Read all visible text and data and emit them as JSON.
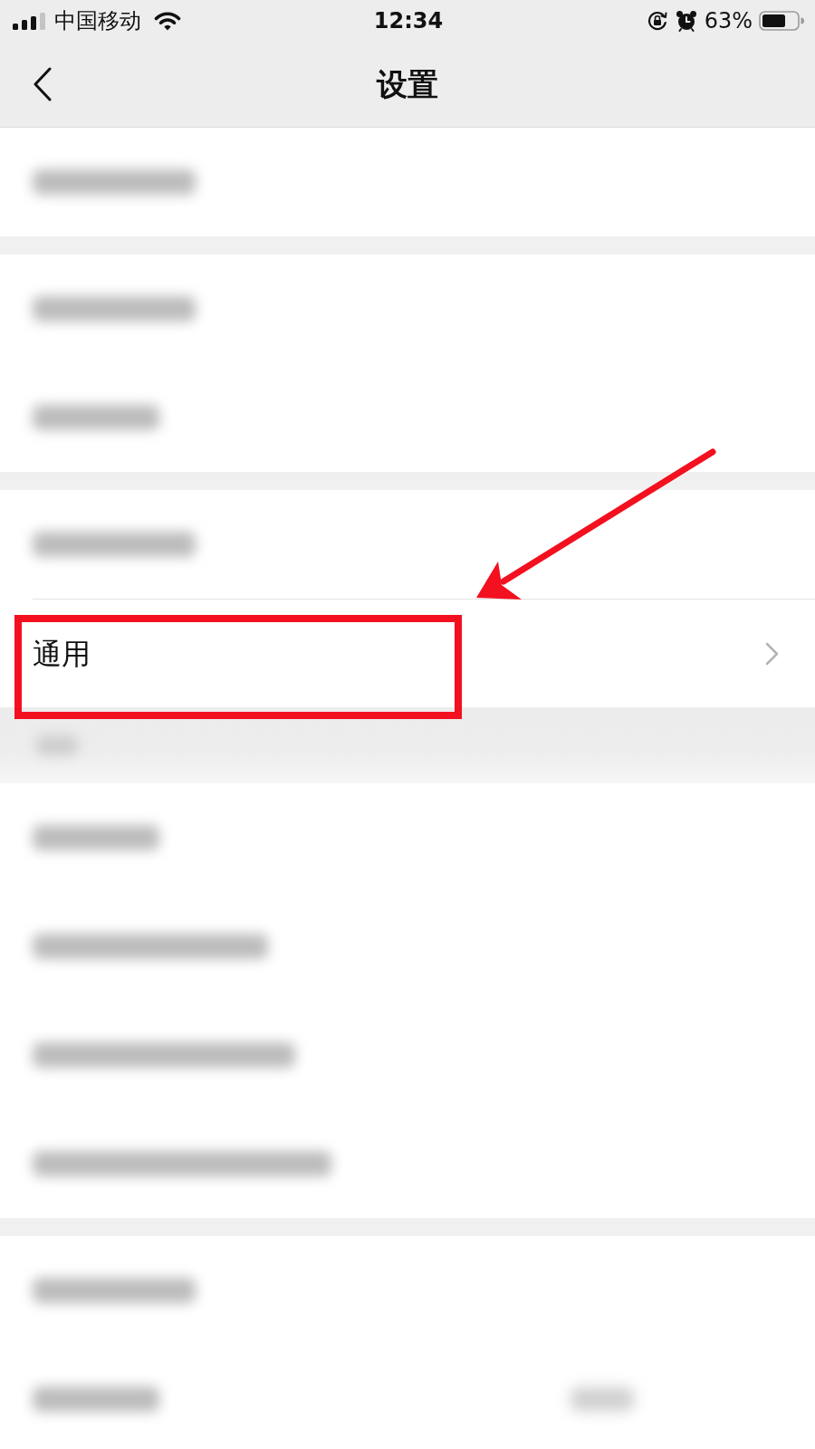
{
  "status_bar": {
    "carrier": "中国移动",
    "time": "12:34",
    "battery": "63%"
  },
  "nav_bar": {
    "title": "设置"
  },
  "sections": [
    {
      "kind": "group",
      "rows": [
        {
          "kind": "blurred",
          "highlighted": false
        }
      ]
    },
    {
      "kind": "group",
      "rows": [
        {
          "kind": "blurred",
          "highlighted": false
        },
        {
          "kind": "blurred",
          "highlighted": false
        }
      ]
    },
    {
      "kind": "group",
      "rows": [
        {
          "kind": "blurred",
          "highlighted": false
        },
        {
          "kind": "text",
          "label": "通用",
          "highlighted": true
        }
      ]
    },
    {
      "kind": "blurred_header"
    },
    {
      "kind": "group",
      "rows": [
        {
          "kind": "blurred",
          "highlighted": false
        },
        {
          "kind": "blurred",
          "highlighted": false
        },
        {
          "kind": "blurred",
          "highlighted": false
        },
        {
          "kind": "blurred",
          "highlighted": false
        }
      ]
    },
    {
      "kind": "group",
      "rows": [
        {
          "kind": "blurred",
          "highlighted": false
        },
        {
          "kind": "blurred_value",
          "highlighted": false
        }
      ]
    }
  ]
}
